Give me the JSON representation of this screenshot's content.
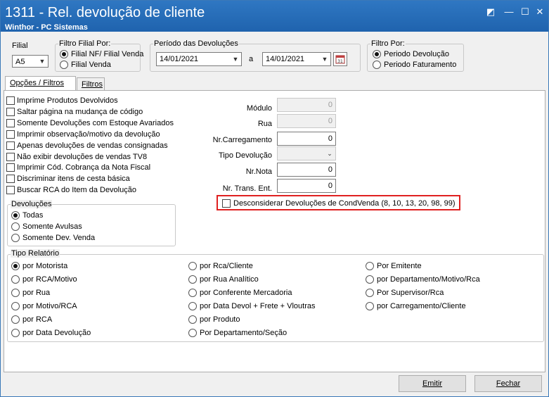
{
  "window": {
    "title": "1311 - Rel. devolução de cliente",
    "subtitle": "Winthor - PC Sistemas",
    "controls": [
      "restore-icon",
      "minimize-icon",
      "maximize-icon",
      "close-icon"
    ]
  },
  "filial": {
    "label": "Filial",
    "value": "A5"
  },
  "filtro_filial": {
    "label": "Filtro Filial Por:",
    "options": [
      {
        "label": "Filial NF/ Filial Venda",
        "selected": true
      },
      {
        "label": "Filial Venda",
        "selected": false
      }
    ]
  },
  "periodo": {
    "label": "Período das Devoluções",
    "from": "14/01/2021",
    "sep": "a",
    "to": "14/01/2021"
  },
  "filtro_por": {
    "label": "Filtro Por:",
    "options": [
      {
        "label": "Periodo Devolução",
        "selected": true
      },
      {
        "label": "Periodo Faturamento",
        "selected": false
      }
    ]
  },
  "tabs": [
    {
      "label": "Opções / Filtros",
      "active": true
    },
    {
      "label": "Filtros",
      "active": false
    }
  ],
  "checkboxes": [
    "Imprime Produtos Devolvidos",
    "Saltar página na mudança de código",
    "Somente Devoluções com Estoque Avariados",
    "Imprimir observação/motivo da devolução",
    "Apenas devoluções de vendas consignadas",
    "Não exibir devoluções de vendas TV8",
    "Imprimir Cód. Cobrança da Nota Fiscal",
    "Discriminar itens de cesta básica",
    "Buscar RCA do Item da Devolução"
  ],
  "fields": {
    "modulo": {
      "label": "Módulo",
      "value": "0"
    },
    "rua": {
      "label": "Rua",
      "value": "0"
    },
    "carregamento": {
      "label": "Nr.Carregamento",
      "value": "0"
    },
    "tipo_devolucao": {
      "label": "Tipo Devolução",
      "value": ""
    },
    "nota": {
      "label": "Nr.Nota",
      "value": "0"
    },
    "trans": {
      "label": "Nr. Trans. Ent.",
      "value": "0"
    }
  },
  "desconsiderar": {
    "label": "Desconsiderar  Devoluções de CondVenda (8, 10, 13, 20, 98, 99)",
    "checked": false
  },
  "devolucoes": {
    "label": "Devoluções",
    "options": [
      {
        "label": "Todas",
        "selected": true
      },
      {
        "label": "Somente Avulsas",
        "selected": false
      },
      {
        "label": "Somente Dev. Venda",
        "selected": false
      }
    ]
  },
  "tipo_relatorio": {
    "label": "Tipo Relatório",
    "col1": [
      {
        "label": "por Motorista",
        "selected": true
      },
      {
        "label": "por RCA/Motivo",
        "selected": false
      },
      {
        "label": "por Rua",
        "selected": false
      },
      {
        "label": "por Motivo/RCA",
        "selected": false
      },
      {
        "label": "por RCA",
        "selected": false
      },
      {
        "label": "por Data Devolução",
        "selected": false
      }
    ],
    "col2": [
      {
        "label": "por Rca/Cliente",
        "selected": false
      },
      {
        "label": "por Rua Analítico",
        "selected": false
      },
      {
        "label": "por Conferente Mercadoria",
        "selected": false
      },
      {
        "label": "por Data Devol + Frete + Vloutras",
        "selected": false
      },
      {
        "label": "por Produto",
        "selected": false
      },
      {
        "label": "Por Departamento/Seção",
        "selected": false
      }
    ],
    "col3": [
      {
        "label": "Por Emitente",
        "selected": false
      },
      {
        "label": "por Departamento/Motivo/Rca",
        "selected": false
      },
      {
        "label": "Por Supervisor/Rca",
        "selected": false
      },
      {
        "label": "por Carregamento/Cliente",
        "selected": false
      }
    ]
  },
  "buttons": {
    "emitir": "Emitir",
    "fechar": "Fechar"
  }
}
